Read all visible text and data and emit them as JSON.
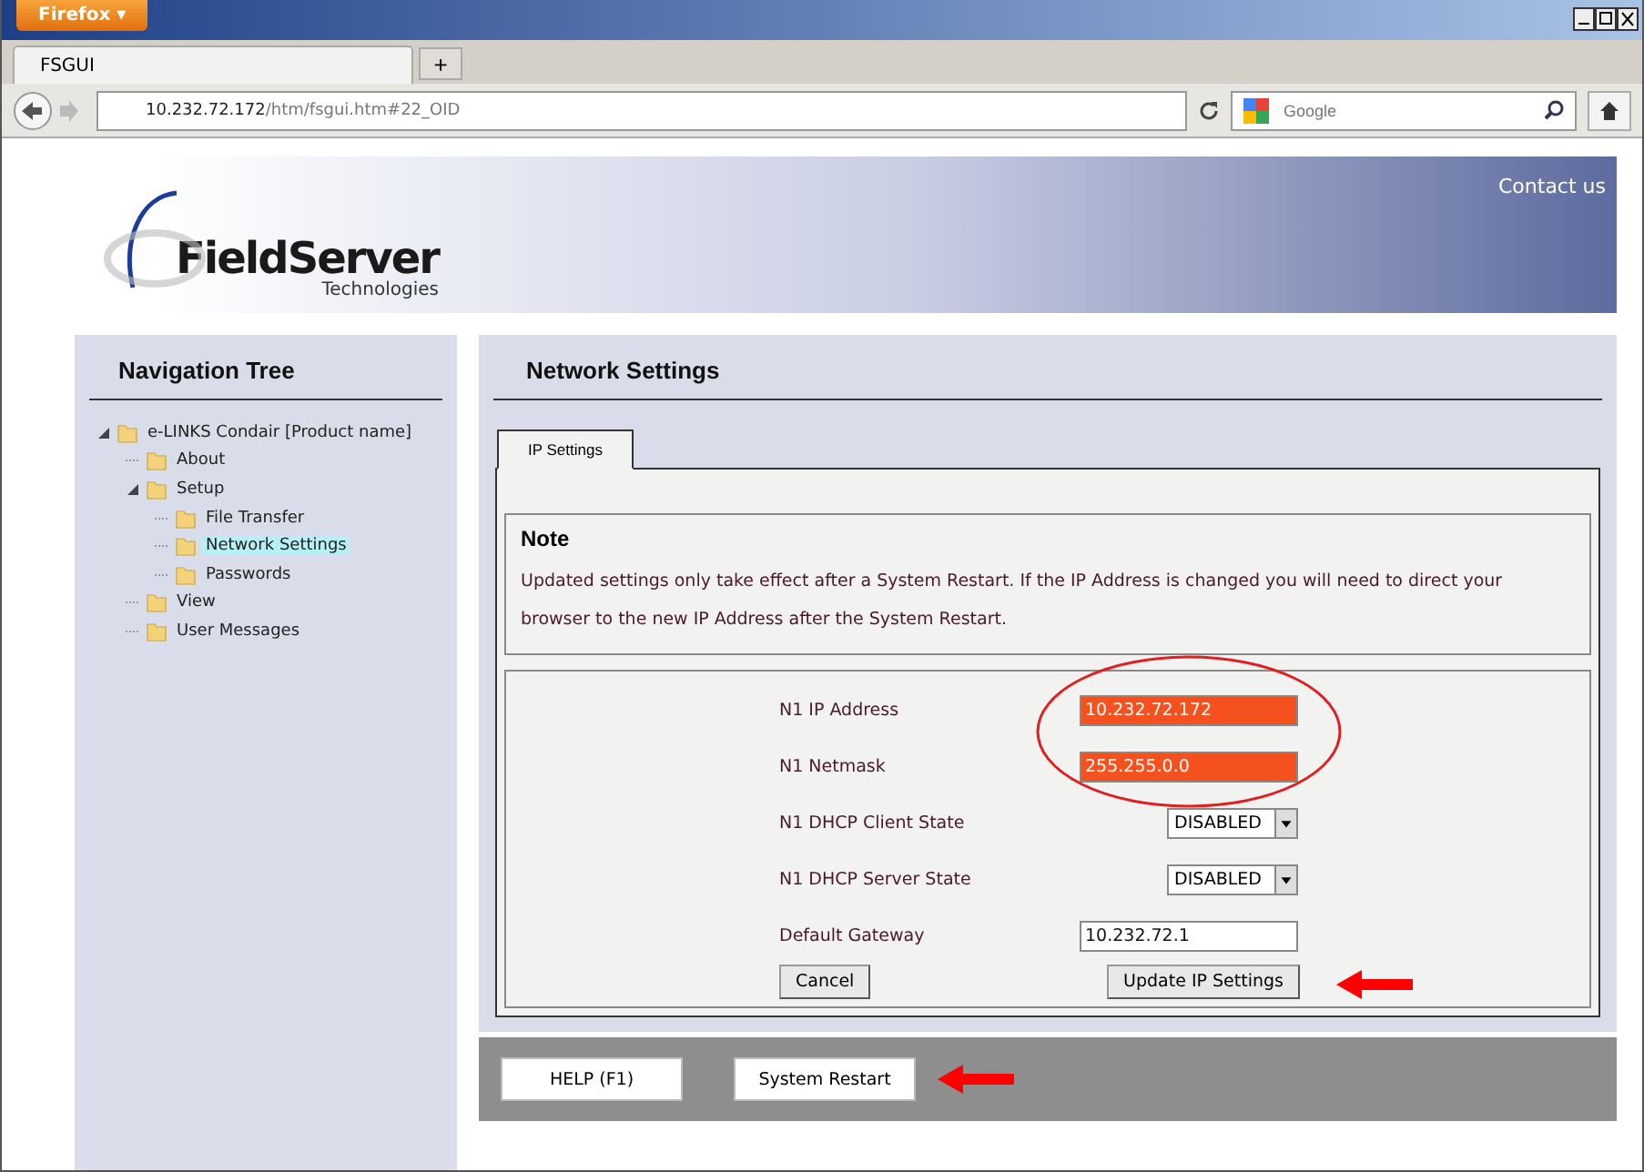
{
  "browser": {
    "menu_button": "Firefox ▾",
    "tab": {
      "title": "FSGUI"
    },
    "new_tab": "+",
    "address": {
      "host": "10.232.72.172",
      "path": "/htm/fsgui.htm#22_OID"
    },
    "search": {
      "placeholder": "Google"
    }
  },
  "header": {
    "logo_name": "FieldServer",
    "logo_sub": "Technologies",
    "contact": "Contact us"
  },
  "nav": {
    "title": "Navigation Tree",
    "items": [
      {
        "label": "e-LINKS Condair [Product name]",
        "selected": false,
        "expanded": true,
        "children": [
          {
            "label": "About",
            "selected": false
          },
          {
            "label": "Setup",
            "selected": false,
            "expanded": true,
            "children": [
              {
                "label": "File Transfer",
                "selected": false
              },
              {
                "label": "Network Settings",
                "selected": true
              },
              {
                "label": "Passwords",
                "selected": false
              }
            ]
          },
          {
            "label": "View",
            "selected": false
          },
          {
            "label": "User Messages",
            "selected": false
          }
        ]
      }
    ]
  },
  "main": {
    "title": "Network Settings",
    "tabs": [
      {
        "label": "IP Settings",
        "selected": true
      }
    ],
    "note": {
      "title": "Note",
      "text": "Updated settings only take effect after a System Restart. If the IP Address is changed you will need to direct your browser to the new IP Address after the System Restart."
    },
    "fields": [
      {
        "label": "N1 IP Address",
        "kind": "text",
        "value": "10.232.72.172",
        "highlighted": true
      },
      {
        "label": "N1 Netmask",
        "kind": "text",
        "value": "255.255.0.0",
        "highlighted": true
      },
      {
        "label": "N1 DHCP Client State",
        "kind": "select",
        "value": "DISABLED"
      },
      {
        "label": "N1 DHCP Server State",
        "kind": "select",
        "value": "DISABLED"
      },
      {
        "label": "Default Gateway",
        "kind": "text",
        "value": "10.232.72.1",
        "highlighted": false
      }
    ],
    "buttons": [
      "Cancel",
      "Update IP Settings"
    ]
  },
  "footer": {
    "buttons": [
      "HELP (F1)",
      "System Restart"
    ]
  }
}
